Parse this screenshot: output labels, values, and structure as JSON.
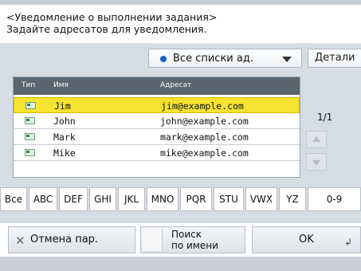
{
  "header": {
    "line1": "<Уведомление о выполнении задания>",
    "line2": "Задайте адресатов для уведомления."
  },
  "dropdown": {
    "selected": "Все списки ад.",
    "icon": "blue-dot-icon"
  },
  "detail_button": "Детали",
  "table": {
    "headers": {
      "type": "Тип",
      "name": "Имя",
      "address": "Адресат"
    },
    "rows": [
      {
        "name": "Jim",
        "address": "jim@example.com",
        "selected": true
      },
      {
        "name": "John",
        "address": "john@example.com",
        "selected": false
      },
      {
        "name": "Mark",
        "address": "mark@example.com",
        "selected": false
      },
      {
        "name": "Mike",
        "address": "mike@example.com",
        "selected": false
      }
    ]
  },
  "pager": {
    "text": "1/1"
  },
  "alpha_tabs": [
    "Все",
    "ABC",
    "DEF",
    "GHI",
    "JKL",
    "MNO",
    "PQR",
    "STU",
    "VWX",
    "YZ",
    "0-9"
  ],
  "bottom": {
    "cancel_label": "Отмена пар.",
    "search_line1": "Поиск",
    "search_line2": "по имени",
    "ok_label": "OK"
  },
  "colors": {
    "selection": "#f7e430",
    "panel": "#d6dce3",
    "header_row": "#5a6572",
    "accent": "#1a63c9"
  }
}
